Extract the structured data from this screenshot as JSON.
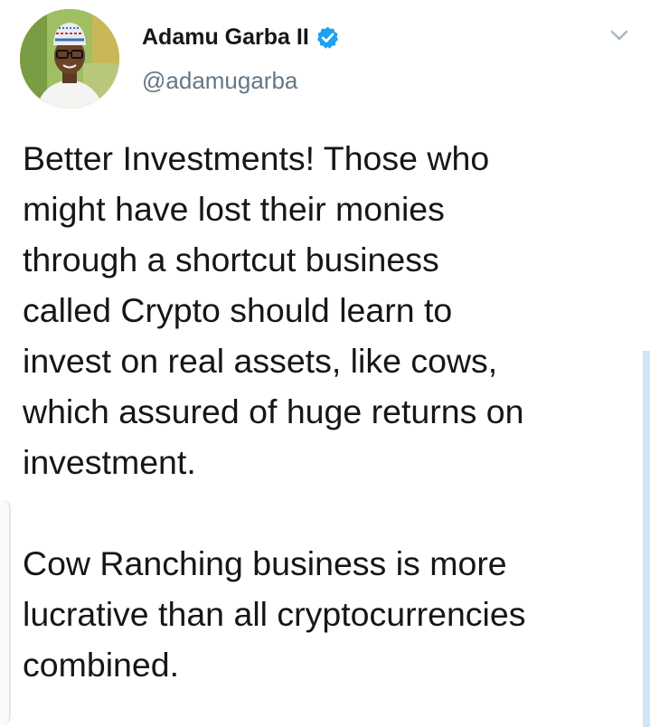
{
  "tweet": {
    "author": {
      "display_name": "Adamu Garba II",
      "handle": "@adamugarba",
      "verified": true,
      "avatar_icon": "profile-photo"
    },
    "menu_icon": "chevron-down-icon",
    "paragraphs": [
      "Better Investments! Those who\nmight have lost their monies\nthrough a shortcut business\ncalled Crypto should learn to\ninvest on real assets, like cows,\nwhich assured of huge returns on\ninvestment.",
      "Cow Ranching business is more\nlucrative than all cryptocurrencies\ncombined."
    ]
  },
  "colors": {
    "text_primary": "#14171a",
    "text_secondary": "#657786",
    "verified_blue": "#1da1f2",
    "chevron_gray": "#aab8c2"
  }
}
